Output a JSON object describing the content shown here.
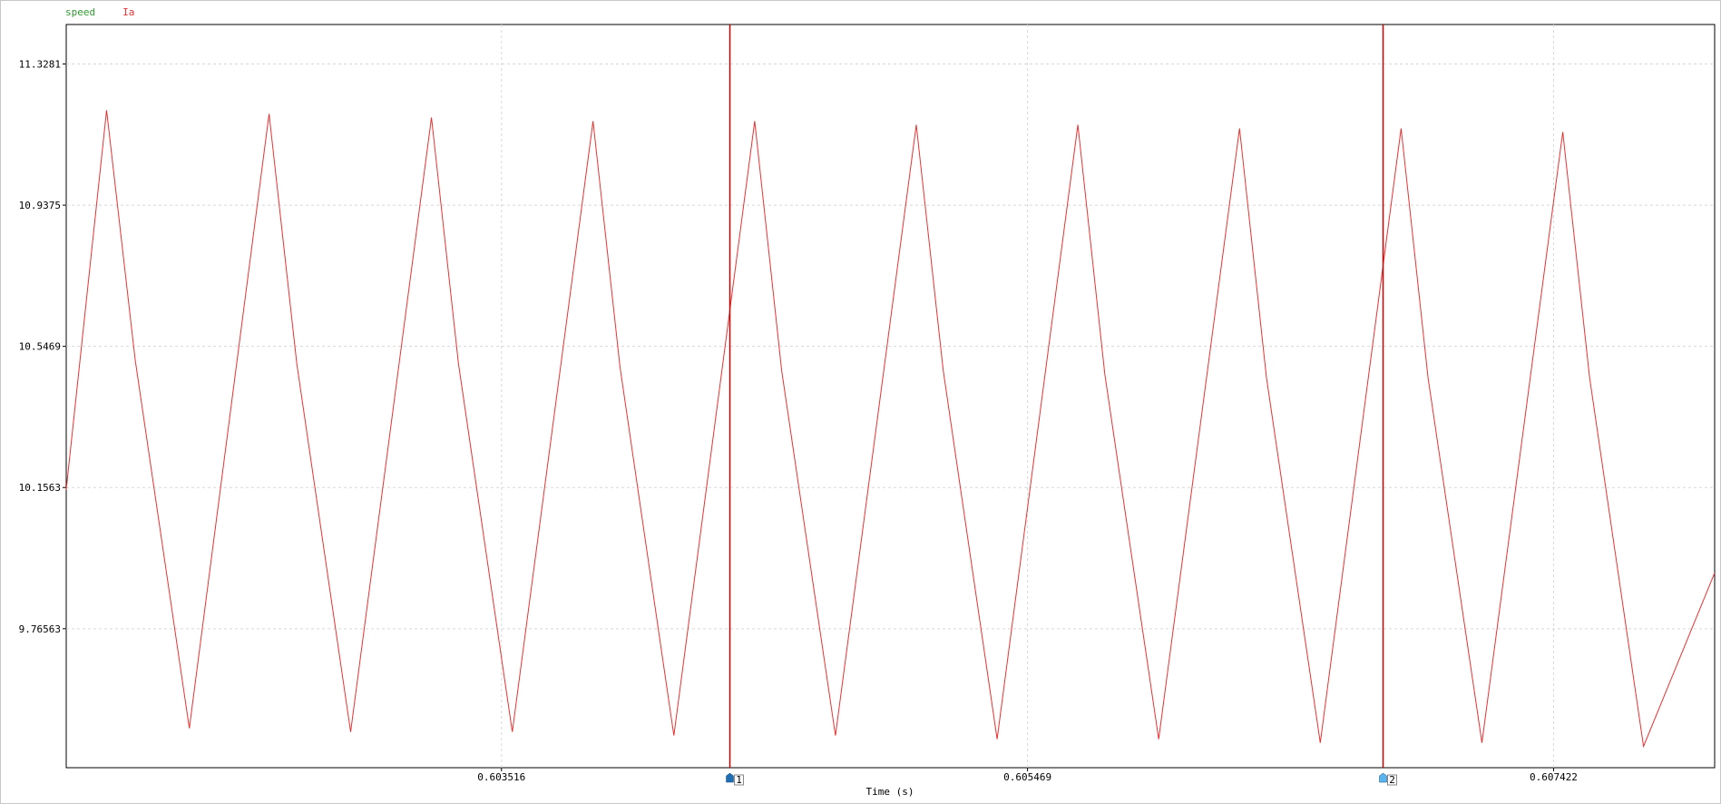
{
  "chart_data": {
    "type": "line",
    "legend": [
      {
        "name": "speed",
        "color": "#2e9b2e"
      },
      {
        "name": "Ia",
        "color": "#e83232"
      }
    ],
    "xlabel": "Time (s)",
    "ylabel": "",
    "x_tick_labels": [
      "0.603516",
      "0.605469",
      "0.607422"
    ],
    "x_ticks": [
      0.603516,
      0.605469,
      0.607422
    ],
    "y_tick_labels": [
      "11.3281",
      "10.9375",
      "10.5469",
      "10.1563",
      "9.76563"
    ],
    "y_ticks": [
      11.3281,
      10.9375,
      10.5469,
      10.1563,
      9.76563
    ],
    "xlim": [
      0.6019,
      0.60802
    ],
    "ylim": [
      9.381,
      11.4374
    ],
    "grid": true,
    "series": [
      {
        "name": "Ia",
        "color": "#e83232",
        "x": [
          0.6019,
          0.60205,
          0.602156,
          0.602357,
          0.602653,
          0.602756,
          0.602956,
          0.603256,
          0.603356,
          0.603556,
          0.603856,
          0.603956,
          0.604156,
          0.604456,
          0.604556,
          0.604756,
          0.605056,
          0.605156,
          0.605356,
          0.605656,
          0.605756,
          0.605956,
          0.606256,
          0.606356,
          0.606556,
          0.606856,
          0.606956,
          0.607156,
          0.607456,
          0.607556,
          0.607756,
          0.60802
        ],
        "y": [
          10.15,
          11.2,
          10.51,
          9.49,
          11.19,
          10.5,
          9.48,
          11.18,
          10.5,
          9.48,
          11.17,
          10.49,
          9.47,
          11.17,
          10.48,
          9.47,
          11.16,
          10.48,
          9.46,
          11.16,
          10.47,
          9.46,
          11.15,
          10.46,
          9.45,
          11.15,
          10.46,
          9.45,
          11.14,
          10.46,
          9.44,
          9.92
        ]
      }
    ],
    "cursors": [
      {
        "label": "1",
        "x": 0.604363,
        "color": "#c80000",
        "marker_color": "#1e6eb4"
      },
      {
        "label": "2",
        "x": 0.606786,
        "color": "#c80000",
        "marker_color": "#5ab4f0"
      }
    ]
  }
}
